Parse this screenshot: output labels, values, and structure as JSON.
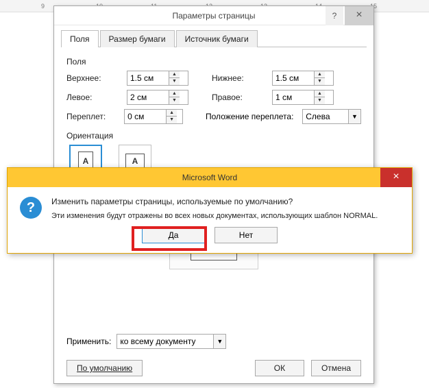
{
  "ruler": {
    "ticks": [
      "9",
      "10",
      "11",
      "12",
      "13",
      "14",
      "15"
    ]
  },
  "dialog": {
    "title": "Параметры страницы",
    "tabs": {
      "margins": "Поля",
      "paper": "Размер бумаги",
      "source": "Источник бумаги"
    },
    "group_margins": "Поля",
    "top_label": "Верхнее:",
    "top_value": "1.5 см",
    "bottom_label": "Нижнее:",
    "bottom_value": "1.5 см",
    "left_label": "Левое:",
    "left_value": "2 см",
    "right_label": "Правое:",
    "right_value": "1 см",
    "gutter_label": "Переплет:",
    "gutter_value": "0 см",
    "gutter_pos_label": "Положение переплета:",
    "gutter_pos_value": "Слева",
    "group_orientation": "Ориентация",
    "orientation_portrait": "книжная",
    "orientation_landscape": "альбомная",
    "apply_label": "Применить:",
    "apply_value": "ко всему документу",
    "default_btn": "По умолчанию",
    "ok_btn": "ОК",
    "cancel_btn": "Отмена"
  },
  "msg": {
    "title": "Microsoft Word",
    "line1": "Изменить параметры страницы, используемые по умолчанию?",
    "line2": "Эти изменения будут отражены во всех новых документах, использующих шаблон NORMAL.",
    "yes": "Да",
    "no": "Нет"
  }
}
